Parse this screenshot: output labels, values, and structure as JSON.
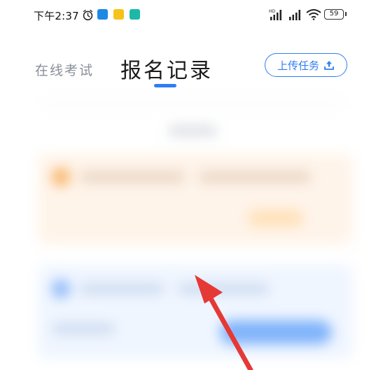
{
  "status_bar": {
    "time": "下午2:37",
    "signal_label": "HD",
    "battery": "59"
  },
  "header": {
    "tabs": [
      {
        "label": "在线考试",
        "active": false
      },
      {
        "label": "报名记录",
        "active": true
      }
    ],
    "upload_label": "上传任务"
  },
  "colors": {
    "accent": "#2f7df6",
    "arrow": "#e53935"
  },
  "icons": {
    "alarm": "alarm-icon",
    "upload": "upload-icon",
    "wifi": "wifi-icon"
  }
}
